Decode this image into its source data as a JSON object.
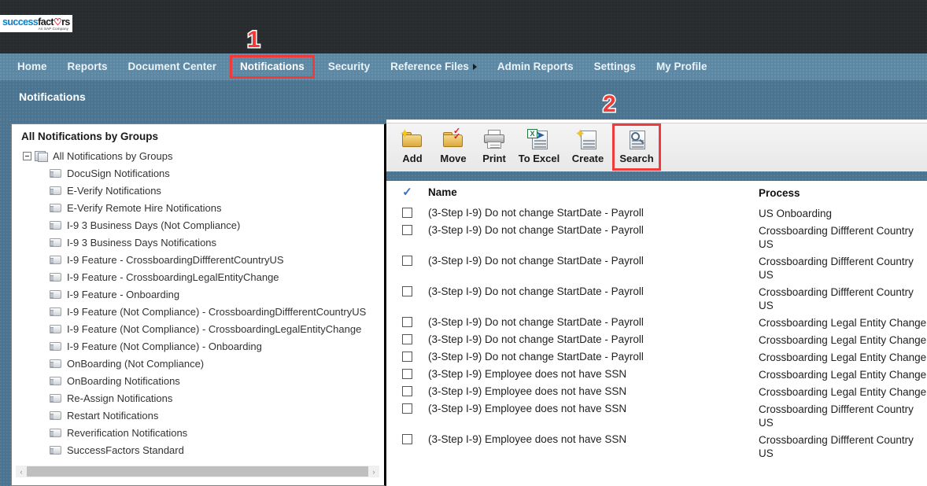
{
  "app": {
    "logo_main_1": "success",
    "logo_main_2": "factors",
    "logo_sub": "An SAP Company"
  },
  "nav": {
    "items": [
      {
        "label": "Home",
        "highlighted": false,
        "caret": false
      },
      {
        "label": "Reports",
        "highlighted": false,
        "caret": false
      },
      {
        "label": "Document Center",
        "highlighted": false,
        "caret": false
      },
      {
        "label": "Notifications",
        "highlighted": true,
        "caret": false
      },
      {
        "label": "Security",
        "highlighted": false,
        "caret": false
      },
      {
        "label": "Reference Files",
        "highlighted": false,
        "caret": true
      },
      {
        "label": "Admin Reports",
        "highlighted": false,
        "caret": false
      },
      {
        "label": "Settings",
        "highlighted": false,
        "caret": false
      },
      {
        "label": "My Profile",
        "highlighted": false,
        "caret": false
      }
    ]
  },
  "page": {
    "title": "Notifications"
  },
  "annotations": [
    {
      "number": "1",
      "target": "Notifications nav tab"
    },
    {
      "number": "2",
      "target": "Search toolbar button"
    }
  ],
  "tree": {
    "header": "All Notifications by Groups",
    "root": {
      "label": "All Notifications by Groups",
      "icon": "stacked-pages-icon",
      "expanded": true
    },
    "items": [
      "DocuSign Notifications",
      "E-Verify Notifications",
      "E-Verify Remote Hire Notifications",
      "I-9 3 Business Days (Not Compliance)",
      "I-9 3 Business Days Notifications",
      "I-9 Feature - CrossboardingDiffferentCountryUS",
      "I-9 Feature - CrossboardingLegalEntityChange",
      "I-9 Feature - Onboarding",
      "I-9 Feature (Not Compliance) - CrossboardingDiffferentCountryUS",
      "I-9 Feature (Not Compliance) - CrossboardingLegalEntityChange",
      "I-9 Feature (Not Compliance) - Onboarding",
      "OnBoarding (Not Compliance)",
      "OnBoarding Notifications",
      "Re-Assign Notifications",
      "Restart Notifications",
      "Reverification Notifications",
      "SuccessFactors Standard"
    ],
    "scroll_left_arrow": "‹",
    "scroll_right_arrow": "›"
  },
  "toolbar": {
    "buttons": [
      {
        "label": "Add",
        "icon": "add-folder-icon",
        "highlighted": false
      },
      {
        "label": "Move",
        "icon": "move-folder-icon",
        "highlighted": false
      },
      {
        "label": "Print",
        "icon": "printer-icon",
        "highlighted": false
      },
      {
        "label": "To Excel",
        "icon": "excel-export-icon",
        "highlighted": false
      },
      {
        "label": "Create",
        "icon": "create-document-icon",
        "highlighted": false
      },
      {
        "label": "Search",
        "icon": "search-document-icon",
        "highlighted": true
      }
    ]
  },
  "grid": {
    "select_all_mark": "✓",
    "columns": {
      "name": "Name",
      "process": "Process"
    },
    "rows": [
      {
        "name": "(3-Step I-9) Do not change StartDate - Payroll",
        "process": "US Onboarding",
        "checked": false
      },
      {
        "name": "(3-Step I-9) Do not change StartDate - Payroll",
        "process": "Crossboarding Diffferent Country US",
        "checked": false
      },
      {
        "name": "(3-Step I-9) Do not change StartDate - Payroll",
        "process": "Crossboarding Diffferent Country US",
        "checked": false
      },
      {
        "name": "(3-Step I-9) Do not change StartDate - Payroll",
        "process": "Crossboarding Diffferent Country US",
        "checked": false
      },
      {
        "name": "(3-Step I-9) Do not change StartDate - Payroll",
        "process": "Crossboarding Legal Entity Change",
        "checked": false
      },
      {
        "name": "(3-Step I-9) Do not change StartDate - Payroll",
        "process": "Crossboarding Legal Entity Change",
        "checked": false
      },
      {
        "name": "(3-Step I-9) Do not change StartDate - Payroll",
        "process": "Crossboarding Legal Entity Change",
        "checked": false
      },
      {
        "name": "(3-Step I-9) Employee does not have SSN",
        "process": "Crossboarding Legal Entity Change",
        "checked": false
      },
      {
        "name": "(3-Step I-9) Employee does not have SSN",
        "process": "Crossboarding Legal Entity Change",
        "checked": false
      },
      {
        "name": "(3-Step I-9) Employee does not have SSN",
        "process": "Crossboarding Diffferent Country US",
        "checked": false
      },
      {
        "name": "(3-Step I-9) Employee does not have SSN",
        "process": "Crossboarding Diffferent Country US",
        "checked": false
      }
    ]
  },
  "colors": {
    "header_dark": "#282c2f",
    "nav_blue": "#5c88a4",
    "panel_blue": "#4b7491",
    "annotation_red": "#ef3b3b",
    "link_light": "#e9f3fa"
  }
}
